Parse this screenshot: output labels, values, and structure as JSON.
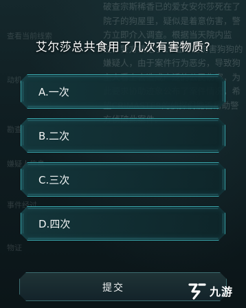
{
  "background": {
    "passage": "破查宗斯稀香已的爱女安尔莎死在了院子的狗屋里，疑似是着意伤害，警方立即介入调查。根据当天院内监控，警方锁定了14位可能伤害狗狗的嫌疑人，由于案件行为恶劣，导致狗主人看上去造成广泛的公民伤害，为此要求协助迹象公布了案件情况，希望CRIMASTER的侦探们能否帮助警方侦破此案件。",
    "side_labels": [
      "查看当前线索",
      "动机",
      "勘查",
      "嫌疑人信息",
      "事件经过",
      "物证"
    ]
  },
  "question": {
    "text": "艾尔莎总共食用了几次有害物质?"
  },
  "options": [
    {
      "label": "A.一次"
    },
    {
      "label": "B.二次"
    },
    {
      "label": "C.三次"
    },
    {
      "label": "D.四次"
    }
  ],
  "submit": {
    "label": "提交"
  },
  "watermark": {
    "text": "九游"
  },
  "colors": {
    "accent": "#39a7ad",
    "background": "#0d1a1e"
  }
}
